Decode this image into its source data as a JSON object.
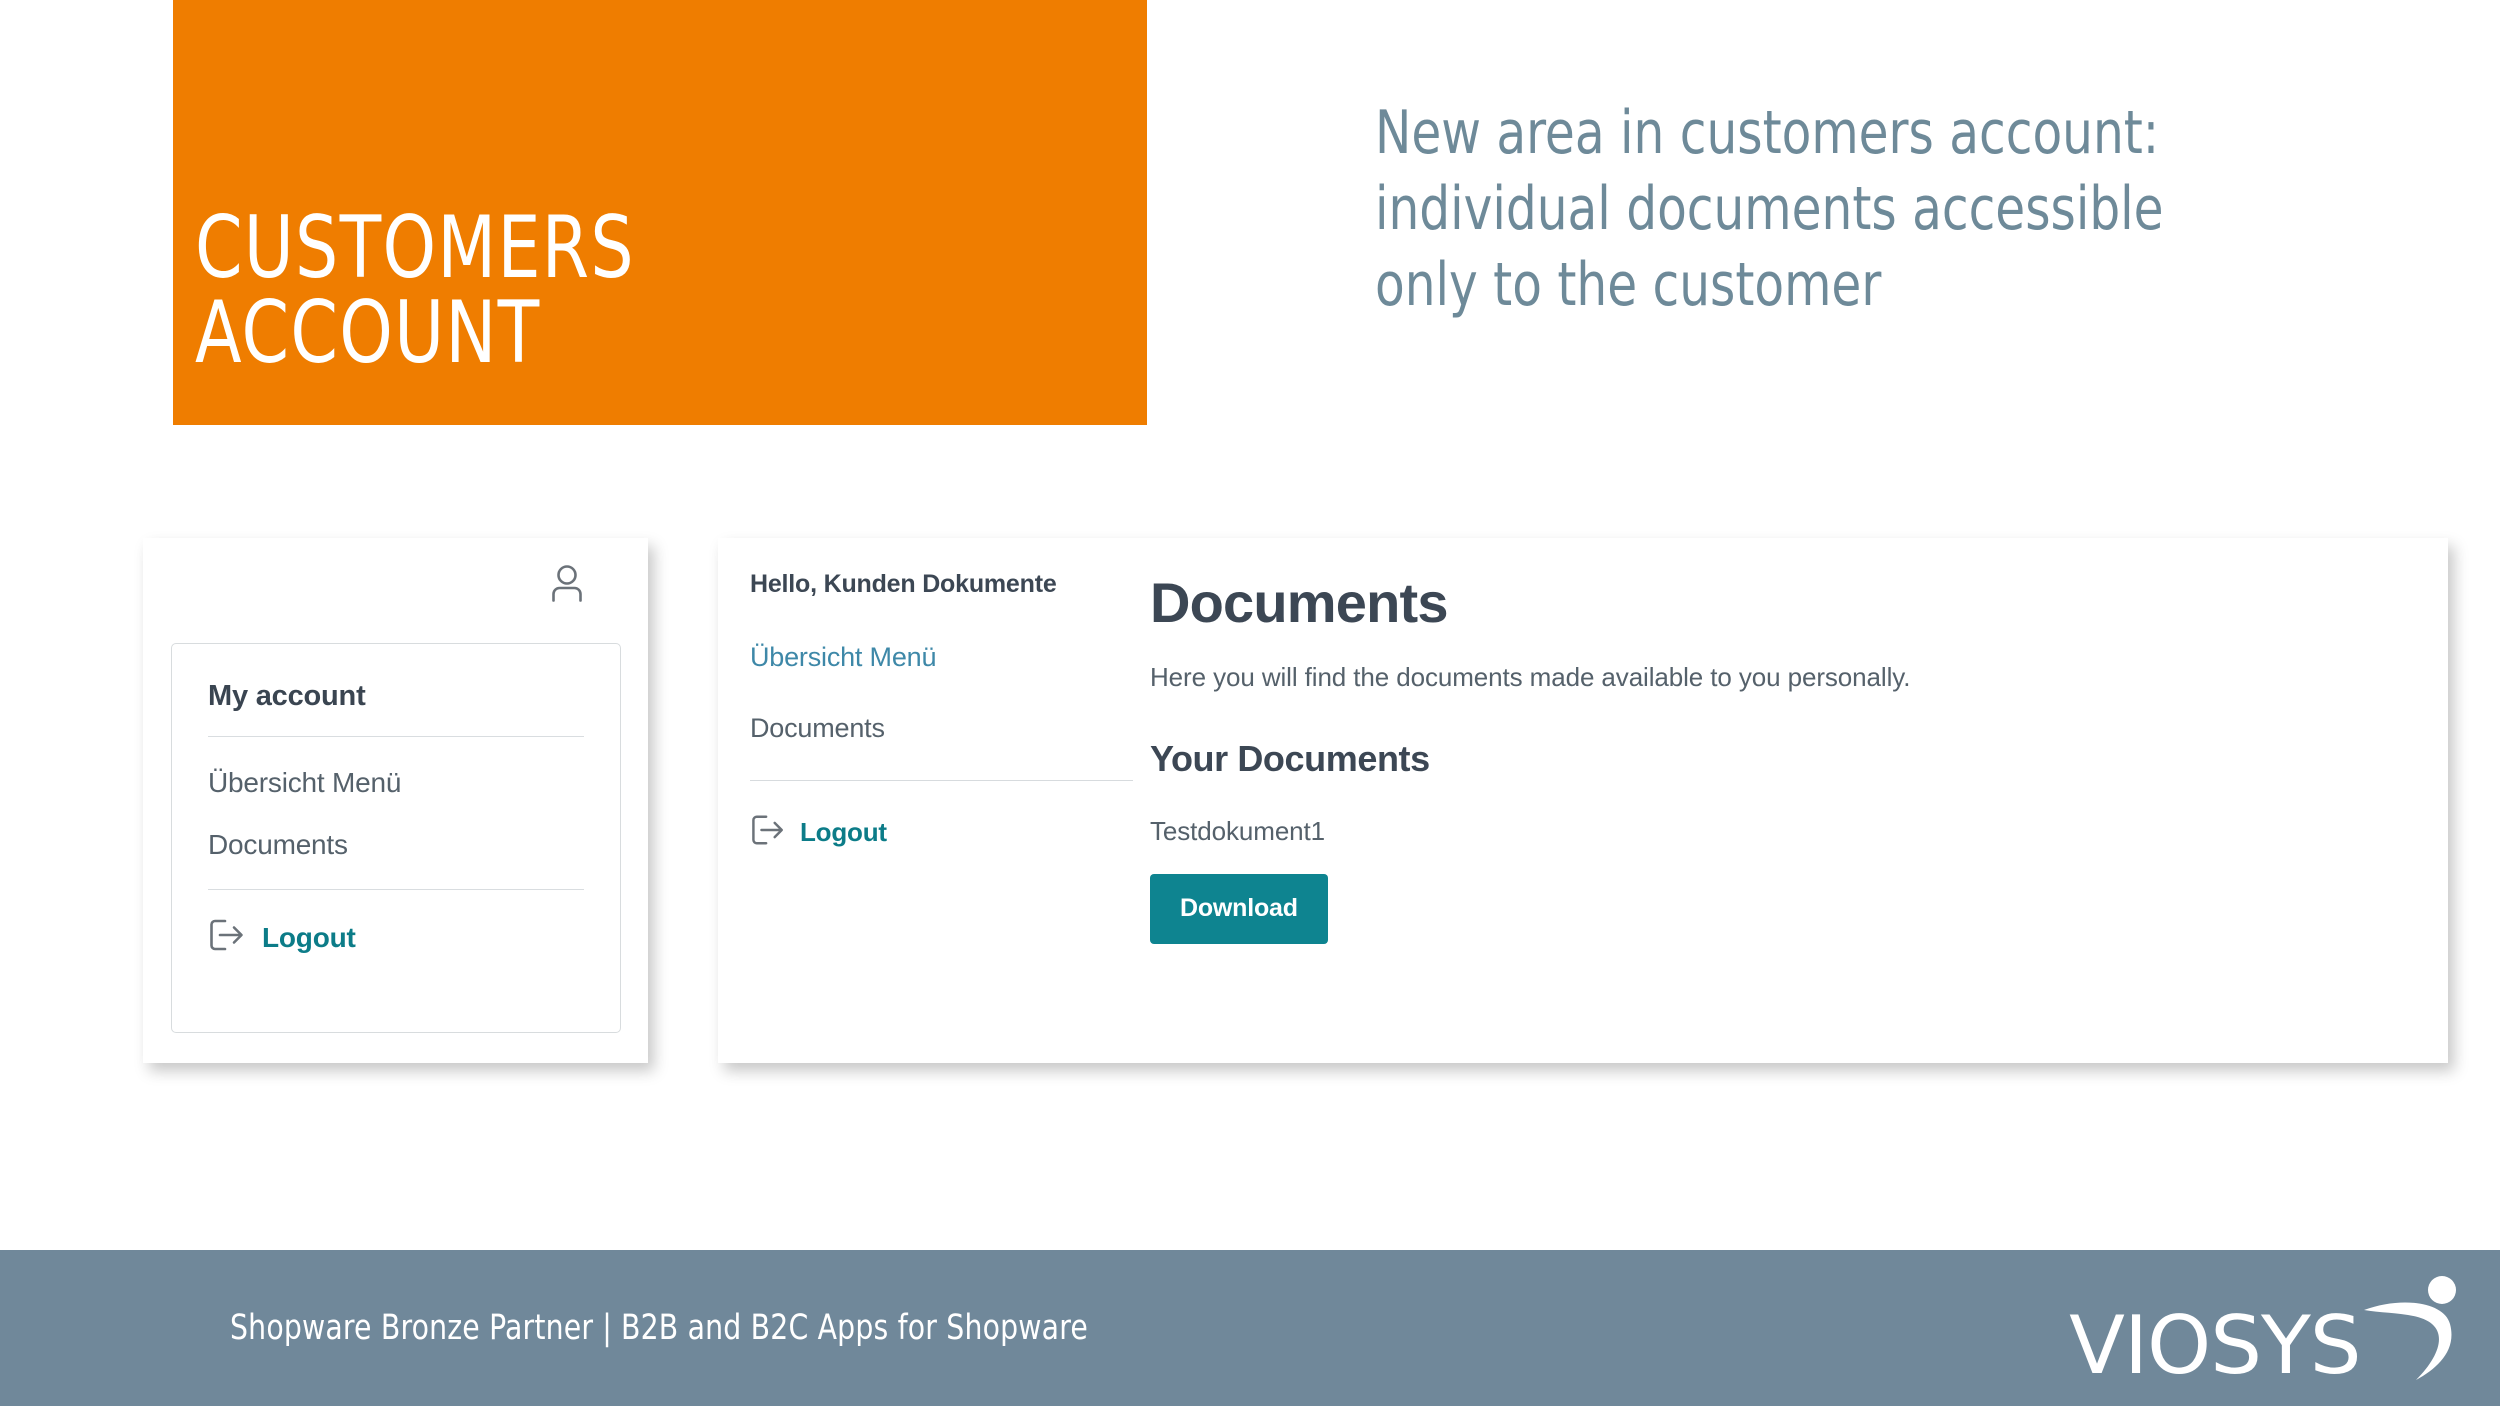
{
  "slide": {
    "badge_title": "CUSTOMERS\nACCOUNT",
    "headline": "New area in customers account: individual documents accessible only to the customer",
    "colors": {
      "orange": "#EF7D00",
      "slate": "#6E8A99",
      "footer_bar": "#70889A",
      "teal": "#0E8490",
      "link_blue": "#3E88A8",
      "text_dark": "#3C4754",
      "text_gray": "#55616B"
    }
  },
  "account_panel": {
    "icons": {
      "person": "person-icon",
      "logout": "logout-icon"
    },
    "card_title": "My account",
    "links": [
      {
        "label": "Übersicht Menü"
      },
      {
        "label": "Documents"
      }
    ],
    "logout_label": "Logout"
  },
  "documents_panel": {
    "nav": {
      "greeting": "Hello, Kunden Dokumente",
      "items": [
        {
          "label": "Übersicht Menü",
          "active": true
        },
        {
          "label": "Documents",
          "active": false
        }
      ],
      "logout_label": "Logout"
    },
    "content": {
      "title": "Documents",
      "intro": "Here you will find the documents made available to you personally.",
      "section_title": "Your Documents",
      "files": [
        {
          "name": "Testdokument1",
          "action_label": "Download"
        }
      ]
    }
  },
  "footer": {
    "left_text_1": "Shopware Bronze Partner",
    "separator": "|",
    "left_text_2": "B2B and B2C Apps for Shopware",
    "logo_word": "VIOSYS"
  }
}
